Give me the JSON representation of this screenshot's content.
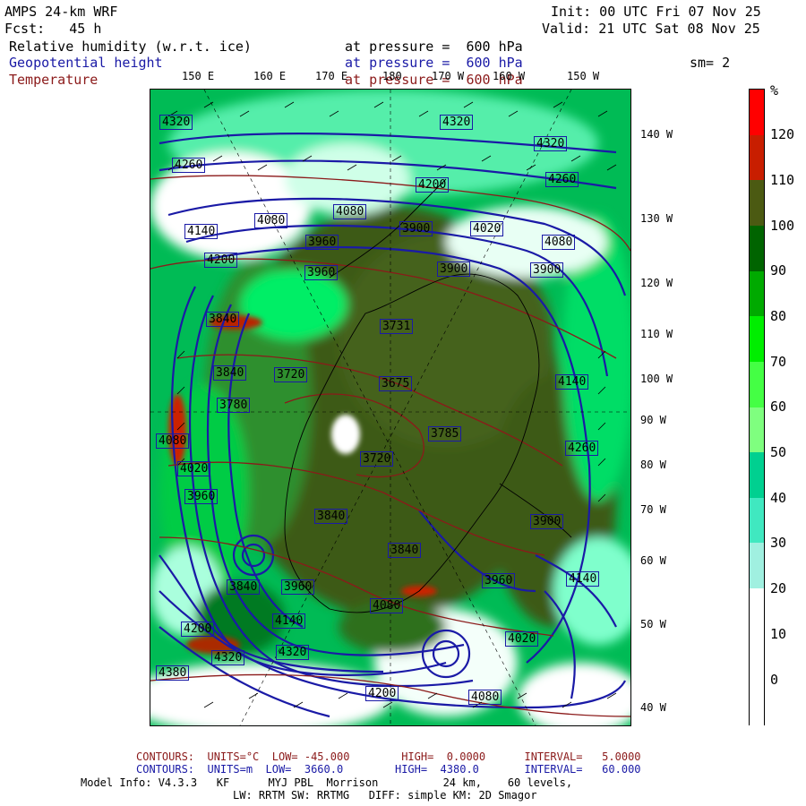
{
  "header": {
    "model": "AMPS 24-km WRF",
    "fcst": "Fcst:   45 h",
    "init": "Init: 00 UTC Fri 07 Nov 25",
    "valid": "Valid: 21 UTC Sat 08 Nov 25",
    "sm": "sm= 2"
  },
  "fields": [
    {
      "name": "Relative humidity (w.r.t. ice)",
      "level": "at pressure =  600 hPa",
      "color": "#000000"
    },
    {
      "name": "Geopotential height",
      "level": "at pressure =  600 hPa",
      "color": "#1a1aa6"
    },
    {
      "name": "Temperature",
      "level": "at pressure =  600 hPa",
      "color": "#8b1a1a"
    }
  ],
  "top_lon_labels": [
    "150 E",
    "160 E",
    "170 E",
    "180",
    "170 W",
    "160 W",
    "150 W"
  ],
  "right_lon_labels": [
    "140 W",
    "130 W",
    "120 W",
    "110 W",
    "100 W",
    "90 W",
    "80 W",
    "70 W",
    "60 W",
    "50 W",
    "40 W"
  ],
  "colorbar": {
    "unit": "%",
    "labels": [
      "120",
      "110",
      "100",
      "90",
      "80",
      "70",
      "60",
      "50",
      "40",
      "30",
      "20",
      "10",
      "0"
    ],
    "colors": [
      "#ff0000",
      "#c81e00",
      "#4b5a12",
      "#006400",
      "#00aa00",
      "#00ee00",
      "#44ff44",
      "#7fff7f",
      "#00d090",
      "#40e8c0",
      "#a0f0e0",
      "#ffffff",
      "#ffffff",
      "#ffffff"
    ]
  },
  "height_labels": [
    "4320",
    "4260",
    "4320",
    "4200",
    "4320",
    "4260",
    "4080",
    "4080",
    "3900",
    "4020",
    "4080",
    "3960",
    "3900",
    "3900",
    "4140",
    "4200",
    "3960",
    "3840",
    "3720",
    "3840",
    "3780",
    "3731",
    "3720",
    "3675",
    "3785",
    "4140",
    "4260",
    "4080",
    "4020",
    "3960",
    "3840",
    "3900",
    "3960",
    "3840",
    "3840",
    "3960",
    "4080",
    "4140",
    "4020",
    "4140",
    "4320",
    "4320",
    "4380",
    "4200",
    "4200",
    "4080"
  ],
  "footer": {
    "temp_contours": "CONTOURS:  UNITS=°C  LOW= -45.000        HIGH=  0.0000      INTERVAL=   5.0000",
    "height_contours": "CONTOURS:  UNITS=m  LOW=  3660.0        HIGH=  4380.0       INTERVAL=   60.000",
    "model_info": "Model Info: V4.3.3   KF      MYJ PBL  Morrison          24 km,    60 levels,",
    "model_info2": "LW: RRTM SW: RRTMG   DIFF: simple KM: 2D Smagor"
  }
}
